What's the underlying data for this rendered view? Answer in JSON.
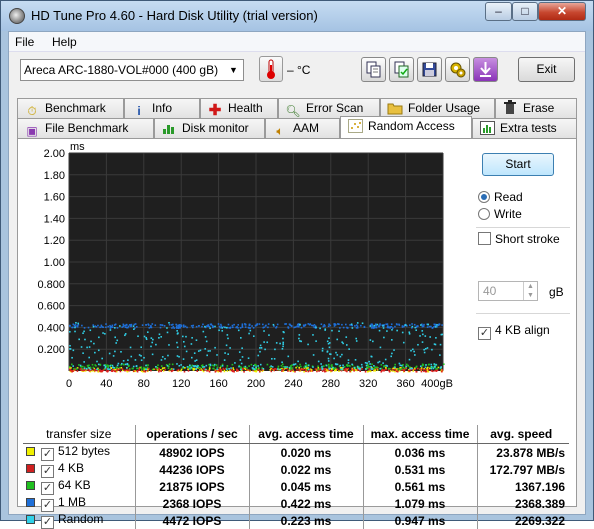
{
  "window": {
    "title": "HD Tune Pro 4.60 - Hard Disk Utility (trial version)",
    "min": "–",
    "max": "□",
    "close": "✕"
  },
  "menu": {
    "file": "File",
    "help": "Help"
  },
  "toolbar": {
    "drive": "Areca   ARC-1880-VOL#000 (400 gB)",
    "temperature": "– °C",
    "exit": "Exit",
    "icons": [
      "copy-icon",
      "copy-all-icon",
      "save-icon",
      "options-icon",
      "download-icon"
    ]
  },
  "tabs_row1": [
    "Benchmark",
    "Info",
    "Health",
    "Error Scan",
    "Folder Usage",
    "Erase"
  ],
  "tabs_row2": [
    "File Benchmark",
    "Disk monitor",
    "AAM",
    "Random Access",
    "Extra tests"
  ],
  "active_tab": "Random Access",
  "controls": {
    "start": "Start",
    "read": "Read",
    "write": "Write",
    "short_stroke": "Short stroke",
    "stroke_value": "40",
    "gb": "gB",
    "align": "4 KB align",
    "read_selected": true,
    "align_checked": true,
    "short_stroke_checked": false
  },
  "chart_data": {
    "type": "scatter",
    "ylabel": "ms",
    "yticks": [
      "2.00",
      "1.80",
      "1.60",
      "1.40",
      "1.20",
      "1.00",
      "0.800",
      "0.600",
      "0.400",
      "0.200"
    ],
    "ylim": [
      0,
      2.0
    ],
    "xticks": [
      "0",
      "40",
      "80",
      "120",
      "160",
      "200",
      "240",
      "280",
      "320",
      "360",
      "400gB"
    ],
    "xlim": [
      0,
      400
    ],
    "grid": true,
    "background": "#1f1f1f",
    "series": [
      {
        "name": "512 bytes",
        "color": "#f0f000",
        "band": [
          0.0,
          0.04
        ]
      },
      {
        "name": "4 KB",
        "color": "#e02020",
        "band": [
          0.0,
          0.03
        ]
      },
      {
        "name": "64 KB",
        "color": "#20c020",
        "band": [
          0.02,
          0.07
        ]
      },
      {
        "name": "1 MB",
        "color": "#1e6fd8",
        "band": [
          0.4,
          0.44
        ]
      },
      {
        "name": "Random",
        "color": "#30d0e8",
        "band": [
          0.02,
          0.45
        ]
      }
    ]
  },
  "results": {
    "headers": [
      "transfer size",
      "operations / sec",
      "avg. access time",
      "max. access time",
      "avg. speed"
    ],
    "rows": [
      {
        "size": "512 bytes",
        "color": "#f0f000",
        "ops": "48902 IOPS",
        "avg": "0.020 ms",
        "max": "0.036 ms",
        "speed": "23.878 MB/s"
      },
      {
        "size": "4 KB",
        "color": "#d02020",
        "ops": "44236 IOPS",
        "avg": "0.022 ms",
        "max": "0.531 ms",
        "speed": "172.797 MB/s"
      },
      {
        "size": "64 KB",
        "color": "#20c020",
        "ops": "21875 IOPS",
        "avg": "0.045 ms",
        "max": "0.561 ms",
        "speed": "1367.196"
      },
      {
        "size": "1 MB",
        "color": "#1e6fd8",
        "ops": "2368 IOPS",
        "avg": "0.422 ms",
        "max": "1.079 ms",
        "speed": "2368.389"
      },
      {
        "size": "Random",
        "color": "#30d0e8",
        "ops": "4472 IOPS",
        "avg": "0.223 ms",
        "max": "0.947 ms",
        "speed": "2269.322"
      }
    ]
  }
}
